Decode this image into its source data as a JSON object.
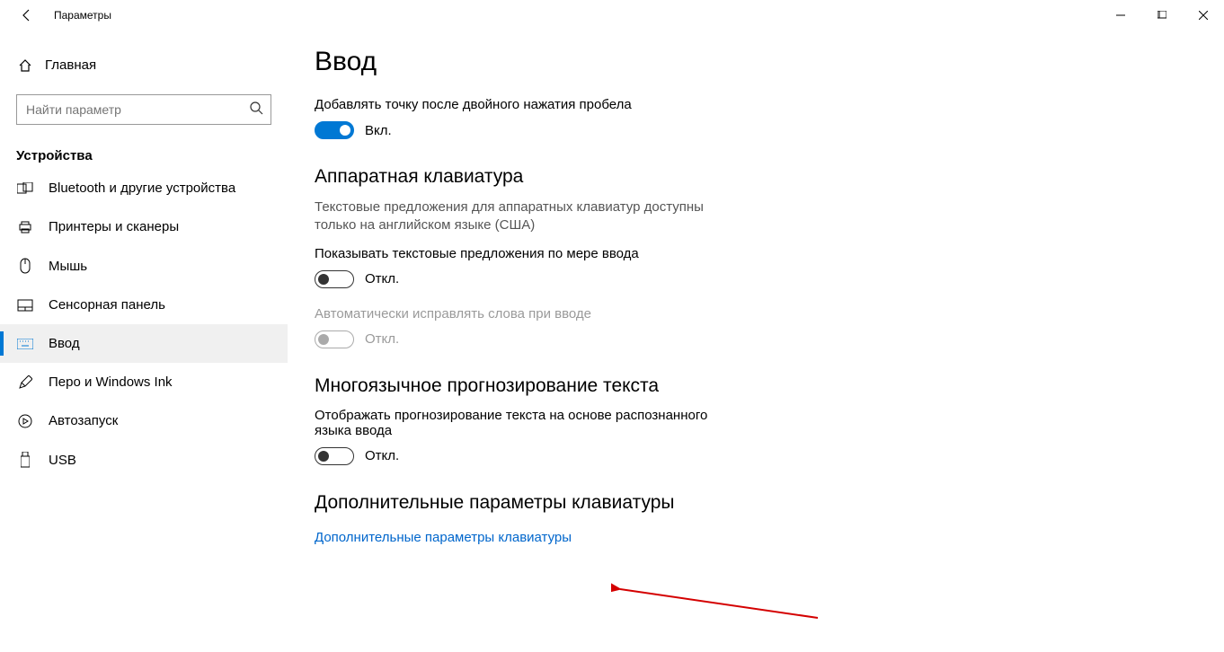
{
  "window": {
    "title": "Параметры"
  },
  "sidebar": {
    "home_label": "Главная",
    "search_placeholder": "Найти параметр",
    "group_label": "Устройства",
    "items": [
      {
        "label": "Bluetooth и другие устройства"
      },
      {
        "label": "Принтеры и сканеры"
      },
      {
        "label": "Мышь"
      },
      {
        "label": "Сенсорная панель"
      },
      {
        "label": "Ввод"
      },
      {
        "label": "Перо и Windows Ink"
      },
      {
        "label": "Автозапуск"
      },
      {
        "label": "USB"
      }
    ]
  },
  "main": {
    "page_title": "Ввод",
    "opt1_label": "Добавлять точку после двойного нажатия пробела",
    "opt1_state": "Вкл.",
    "section2_title": "Аппаратная клавиатура",
    "section2_desc": "Текстовые предложения для аппаратных клавиатур доступны только на английском языке (США)",
    "opt2_label": "Показывать текстовые предложения по мере ввода",
    "opt2_state": "Откл.",
    "opt3_label": "Автоматически исправлять слова при вводе",
    "opt3_state": "Откл.",
    "section3_title": "Многоязычное прогнозирование текста",
    "opt4_label": "Отображать прогнозирование текста на основе распознанного языка ввода",
    "opt4_state": "Откл.",
    "section4_title": "Дополнительные параметры клавиатуры",
    "link_label": "Дополнительные параметры клавиатуры"
  }
}
